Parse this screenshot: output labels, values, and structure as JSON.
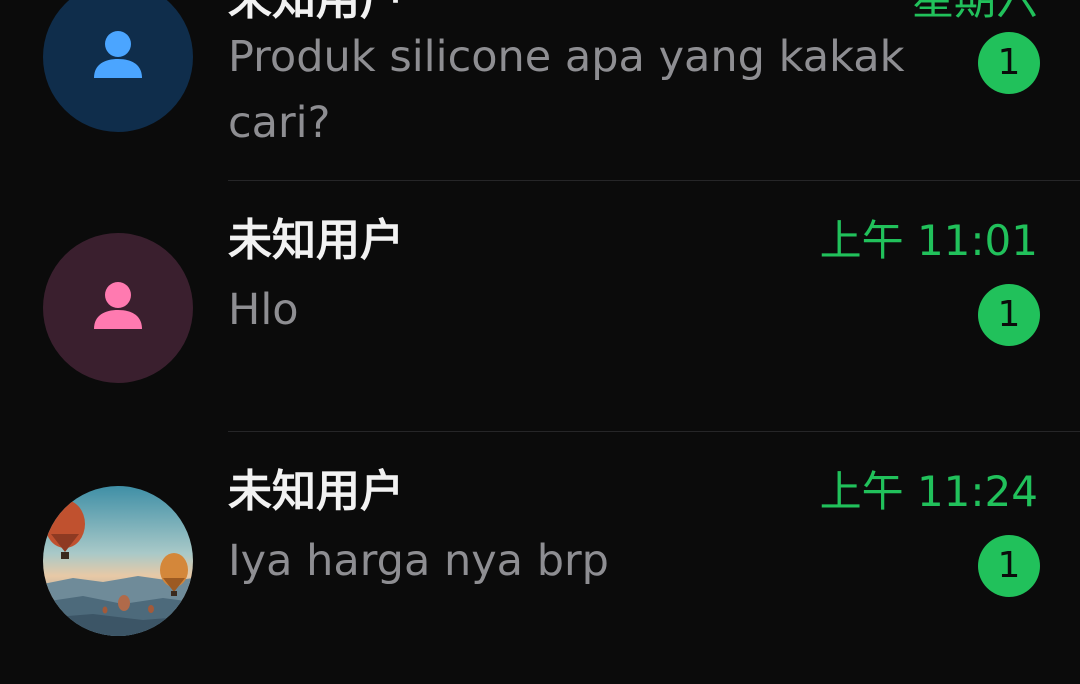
{
  "colors": {
    "background": "#0b0b0b",
    "accent": "#21c15b",
    "preview_text": "#8e8e92",
    "divider": "#262628"
  },
  "chats": [
    {
      "name": "未知用户",
      "time": "星期六",
      "preview": "Produk silicone apa yang kakak cari?",
      "unread": "1",
      "avatar": "blue-person-icon"
    },
    {
      "name": "未知用户",
      "time": "上午 11:01",
      "preview": "Hlo",
      "unread": "1",
      "avatar": "pink-person-icon"
    },
    {
      "name": "未知用户",
      "time": "上午 11:24",
      "preview": "Iya harga nya brp",
      "unread": "1",
      "avatar": "hot-air-balloon-photo"
    }
  ]
}
